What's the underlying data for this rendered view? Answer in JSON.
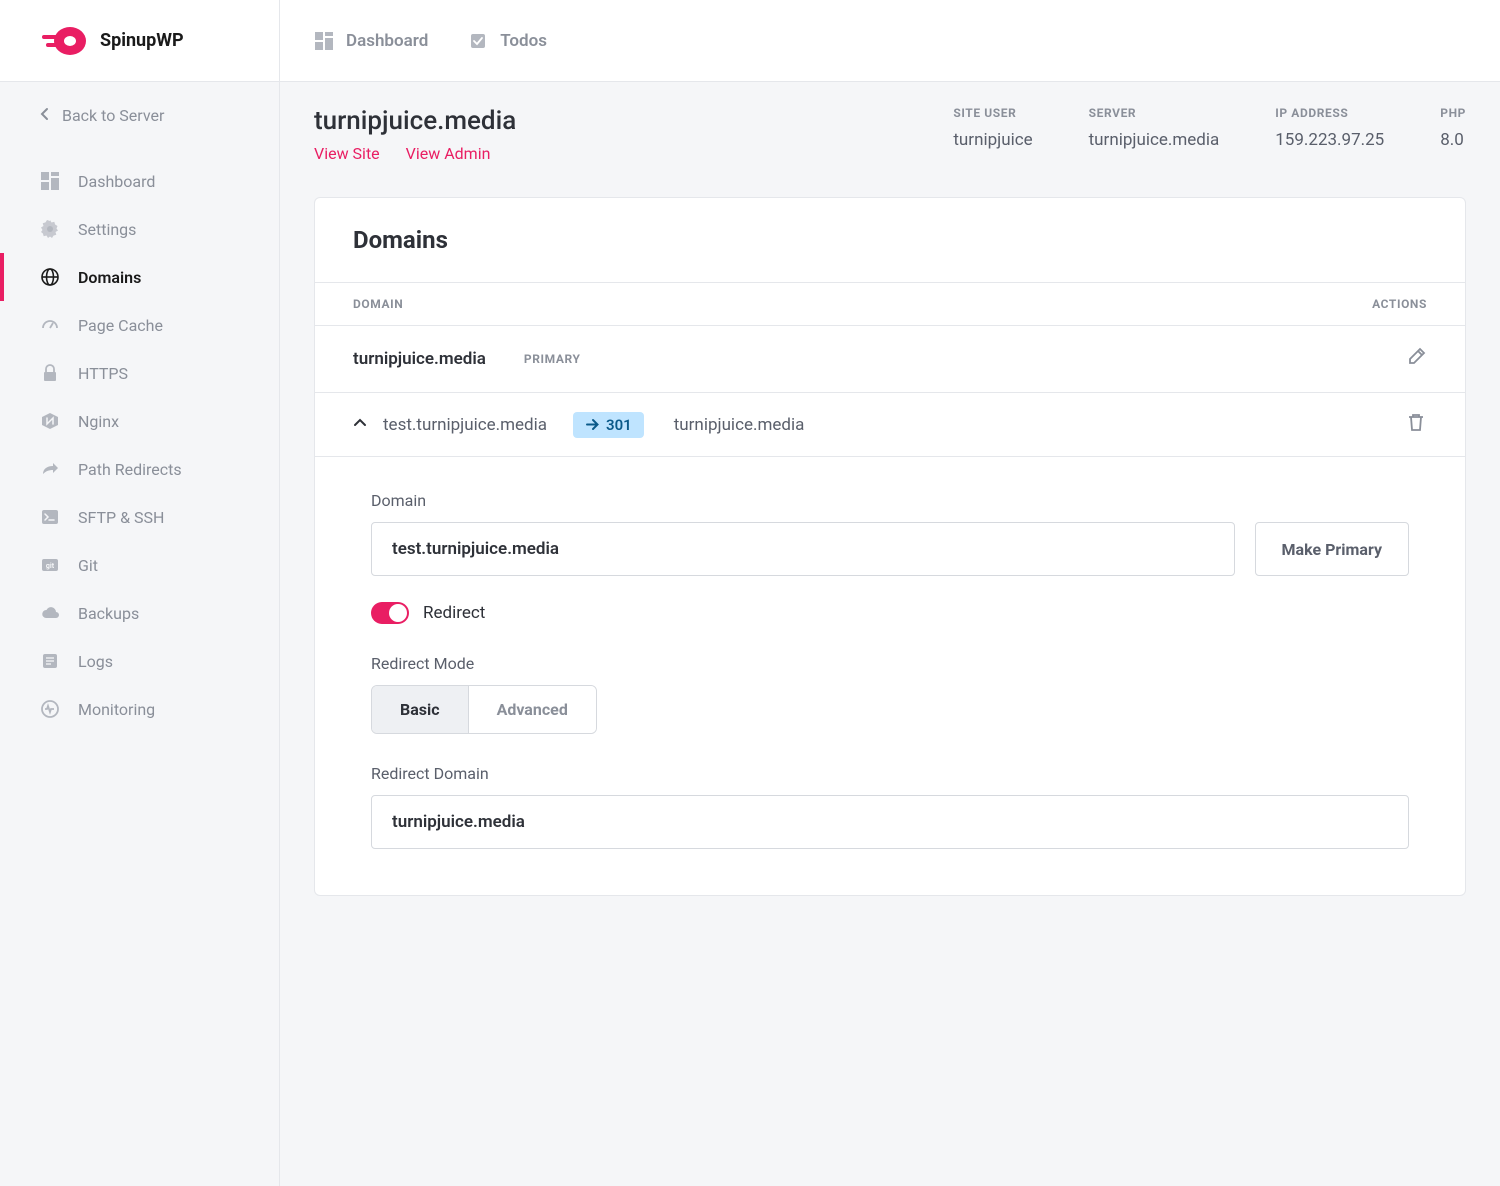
{
  "brand": "SpinupWP",
  "back_link": "Back to Server",
  "topbar": {
    "dashboard": "Dashboard",
    "todos": "Todos"
  },
  "sidebar": {
    "items": [
      {
        "label": "Dashboard"
      },
      {
        "label": "Settings"
      },
      {
        "label": "Domains"
      },
      {
        "label": "Page Cache"
      },
      {
        "label": "HTTPS"
      },
      {
        "label": "Nginx"
      },
      {
        "label": "Path Redirects"
      },
      {
        "label": "SFTP & SSH"
      },
      {
        "label": "Git"
      },
      {
        "label": "Backups"
      },
      {
        "label": "Logs"
      },
      {
        "label": "Monitoring"
      }
    ]
  },
  "site": {
    "title": "turnipjuice.media",
    "view_site": "View Site",
    "view_admin": "View Admin",
    "meta": {
      "site_user_label": "SITE USER",
      "site_user_value": "turnipjuice",
      "server_label": "SERVER",
      "server_value": "turnipjuice.media",
      "ip_label": "IP ADDRESS",
      "ip_value": "159.223.97.25",
      "php_label": "PHP",
      "php_value": "8.0"
    }
  },
  "card": {
    "title": "Domains",
    "col_domain": "DOMAIN",
    "col_actions": "ACTIONS",
    "primary_row": {
      "name": "turnipjuice.media",
      "badge": "PRIMARY"
    },
    "redirect_row": {
      "source": "test.turnipjuice.media",
      "code": "301",
      "target": "turnipjuice.media"
    }
  },
  "form": {
    "domain_label": "Domain",
    "domain_value": "test.turnipjuice.media",
    "make_primary": "Make Primary",
    "redirect_toggle_label": "Redirect",
    "redirect_mode_label": "Redirect Mode",
    "mode_basic": "Basic",
    "mode_advanced": "Advanced",
    "redirect_domain_label": "Redirect Domain",
    "redirect_domain_value": "turnipjuice.media"
  }
}
